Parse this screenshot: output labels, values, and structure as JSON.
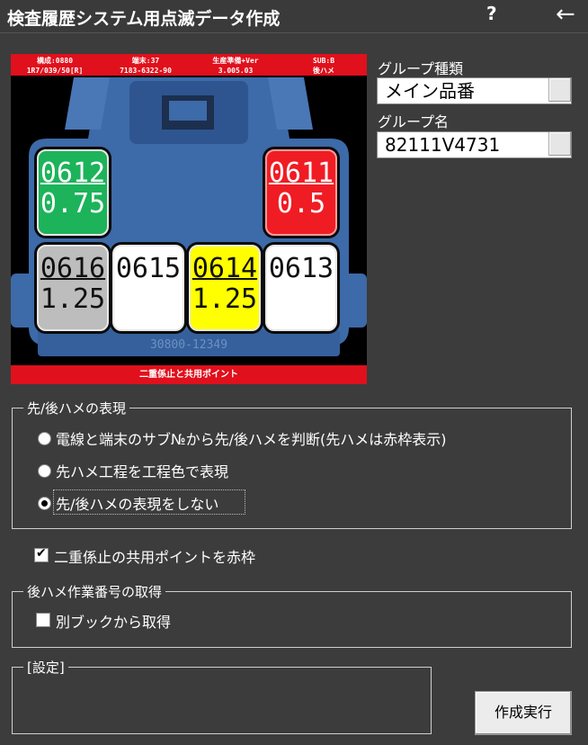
{
  "window": {
    "title": "検査履歴システム用点滅データ作成",
    "help": "?",
    "back": "←"
  },
  "preview": {
    "header": [
      {
        "line1": "構成:0880",
        "line2": "1R7/039/50[R]"
      },
      {
        "line1": "端末:37",
        "line2": "7183-6322-90"
      },
      {
        "line1": "生産準備+Ver",
        "line2": "3.005.03"
      },
      {
        "line1": "SUB:B",
        "line2": "後ハメ"
      }
    ],
    "cells": [
      {
        "num": "0612",
        "val": "0.75",
        "color": "#1db35a"
      },
      {
        "num": "0611",
        "val": "0.5",
        "color": "#f01c24"
      },
      {
        "num": "0616",
        "val": "1.25",
        "color": "#bdbdbd"
      },
      {
        "num": "0615",
        "val": "",
        "color": "#ffffff"
      },
      {
        "num": "0614",
        "val": "1.25",
        "color": "#ffff00"
      },
      {
        "num": "0613",
        "val": "",
        "color": "#ffffff"
      }
    ],
    "connector_marking": "30800-12349",
    "footer": "二重係止と共用ポイント"
  },
  "group_type": {
    "label": "グループ種類",
    "value": "メイン品番"
  },
  "group_name": {
    "label": "グループ名",
    "value": "82111V4731"
  },
  "fit_expression": {
    "title": "先/後ハメの表現",
    "options": [
      "電線と端末のサブ№から先/後ハメを判断(先ハメは赤枠表示)",
      "先ハメ工程を工程色で表現",
      "先/後ハメの表現をしない"
    ],
    "selected_index": 2
  },
  "double_lock_checkbox": {
    "label": "二重係止の共用ポイントを赤枠",
    "checked": true
  },
  "post_fit_number": {
    "title": "後ハメ作業番号の取得",
    "checkbox_label": "別ブックから取得",
    "checked": false
  },
  "settings": {
    "title": "[設定]"
  },
  "run_button": {
    "label": "作成実行"
  }
}
